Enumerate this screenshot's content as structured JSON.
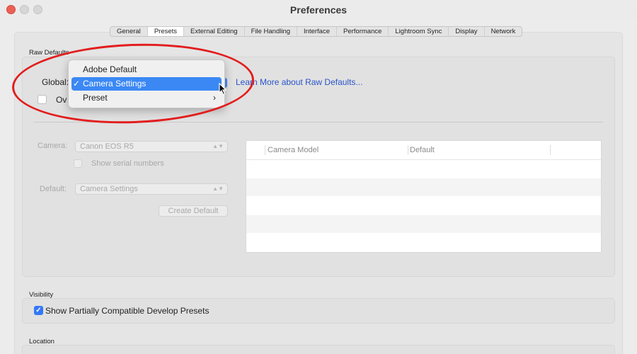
{
  "window": {
    "title": "Preferences"
  },
  "tabs": [
    {
      "label": "General",
      "active": false
    },
    {
      "label": "Presets",
      "active": true
    },
    {
      "label": "External Editing",
      "active": false
    },
    {
      "label": "File Handling",
      "active": false
    },
    {
      "label": "Interface",
      "active": false
    },
    {
      "label": "Performance",
      "active": false
    },
    {
      "label": "Lightroom Sync",
      "active": false
    },
    {
      "label": "Display",
      "active": false
    },
    {
      "label": "Network",
      "active": false
    }
  ],
  "raw_defaults": {
    "section_label": "Raw Defaults",
    "global_label": "Global:",
    "learn_more_link": "Learn More about Raw Defaults...",
    "override_label": "Ov",
    "camera_label": "Camera:",
    "camera_value": "Canon EOS R5",
    "show_serial_label": "Show serial numbers",
    "default_label": "Default:",
    "default_value": "Camera Settings",
    "create_default_button": "Create Default",
    "table": {
      "columns": [
        "Camera Model",
        "Default"
      ],
      "rows": []
    }
  },
  "dropdown_menu": {
    "items": [
      {
        "label": "Adobe Default",
        "selected": false,
        "submenu": false
      },
      {
        "label": "Camera Settings",
        "selected": true,
        "submenu": false
      },
      {
        "label": "Preset",
        "selected": false,
        "submenu": true
      }
    ],
    "check_glyph": "✓",
    "submenu_glyph": "›"
  },
  "visibility": {
    "section_label": "Visibility",
    "show_partial_label": "Show Partially Compatible Develop Presets",
    "show_partial_checked": true
  },
  "location": {
    "section_label": "Location"
  },
  "colors": {
    "accent": "#3b88f5",
    "annotation": "#e21e1e",
    "link": "#2a55c9"
  }
}
